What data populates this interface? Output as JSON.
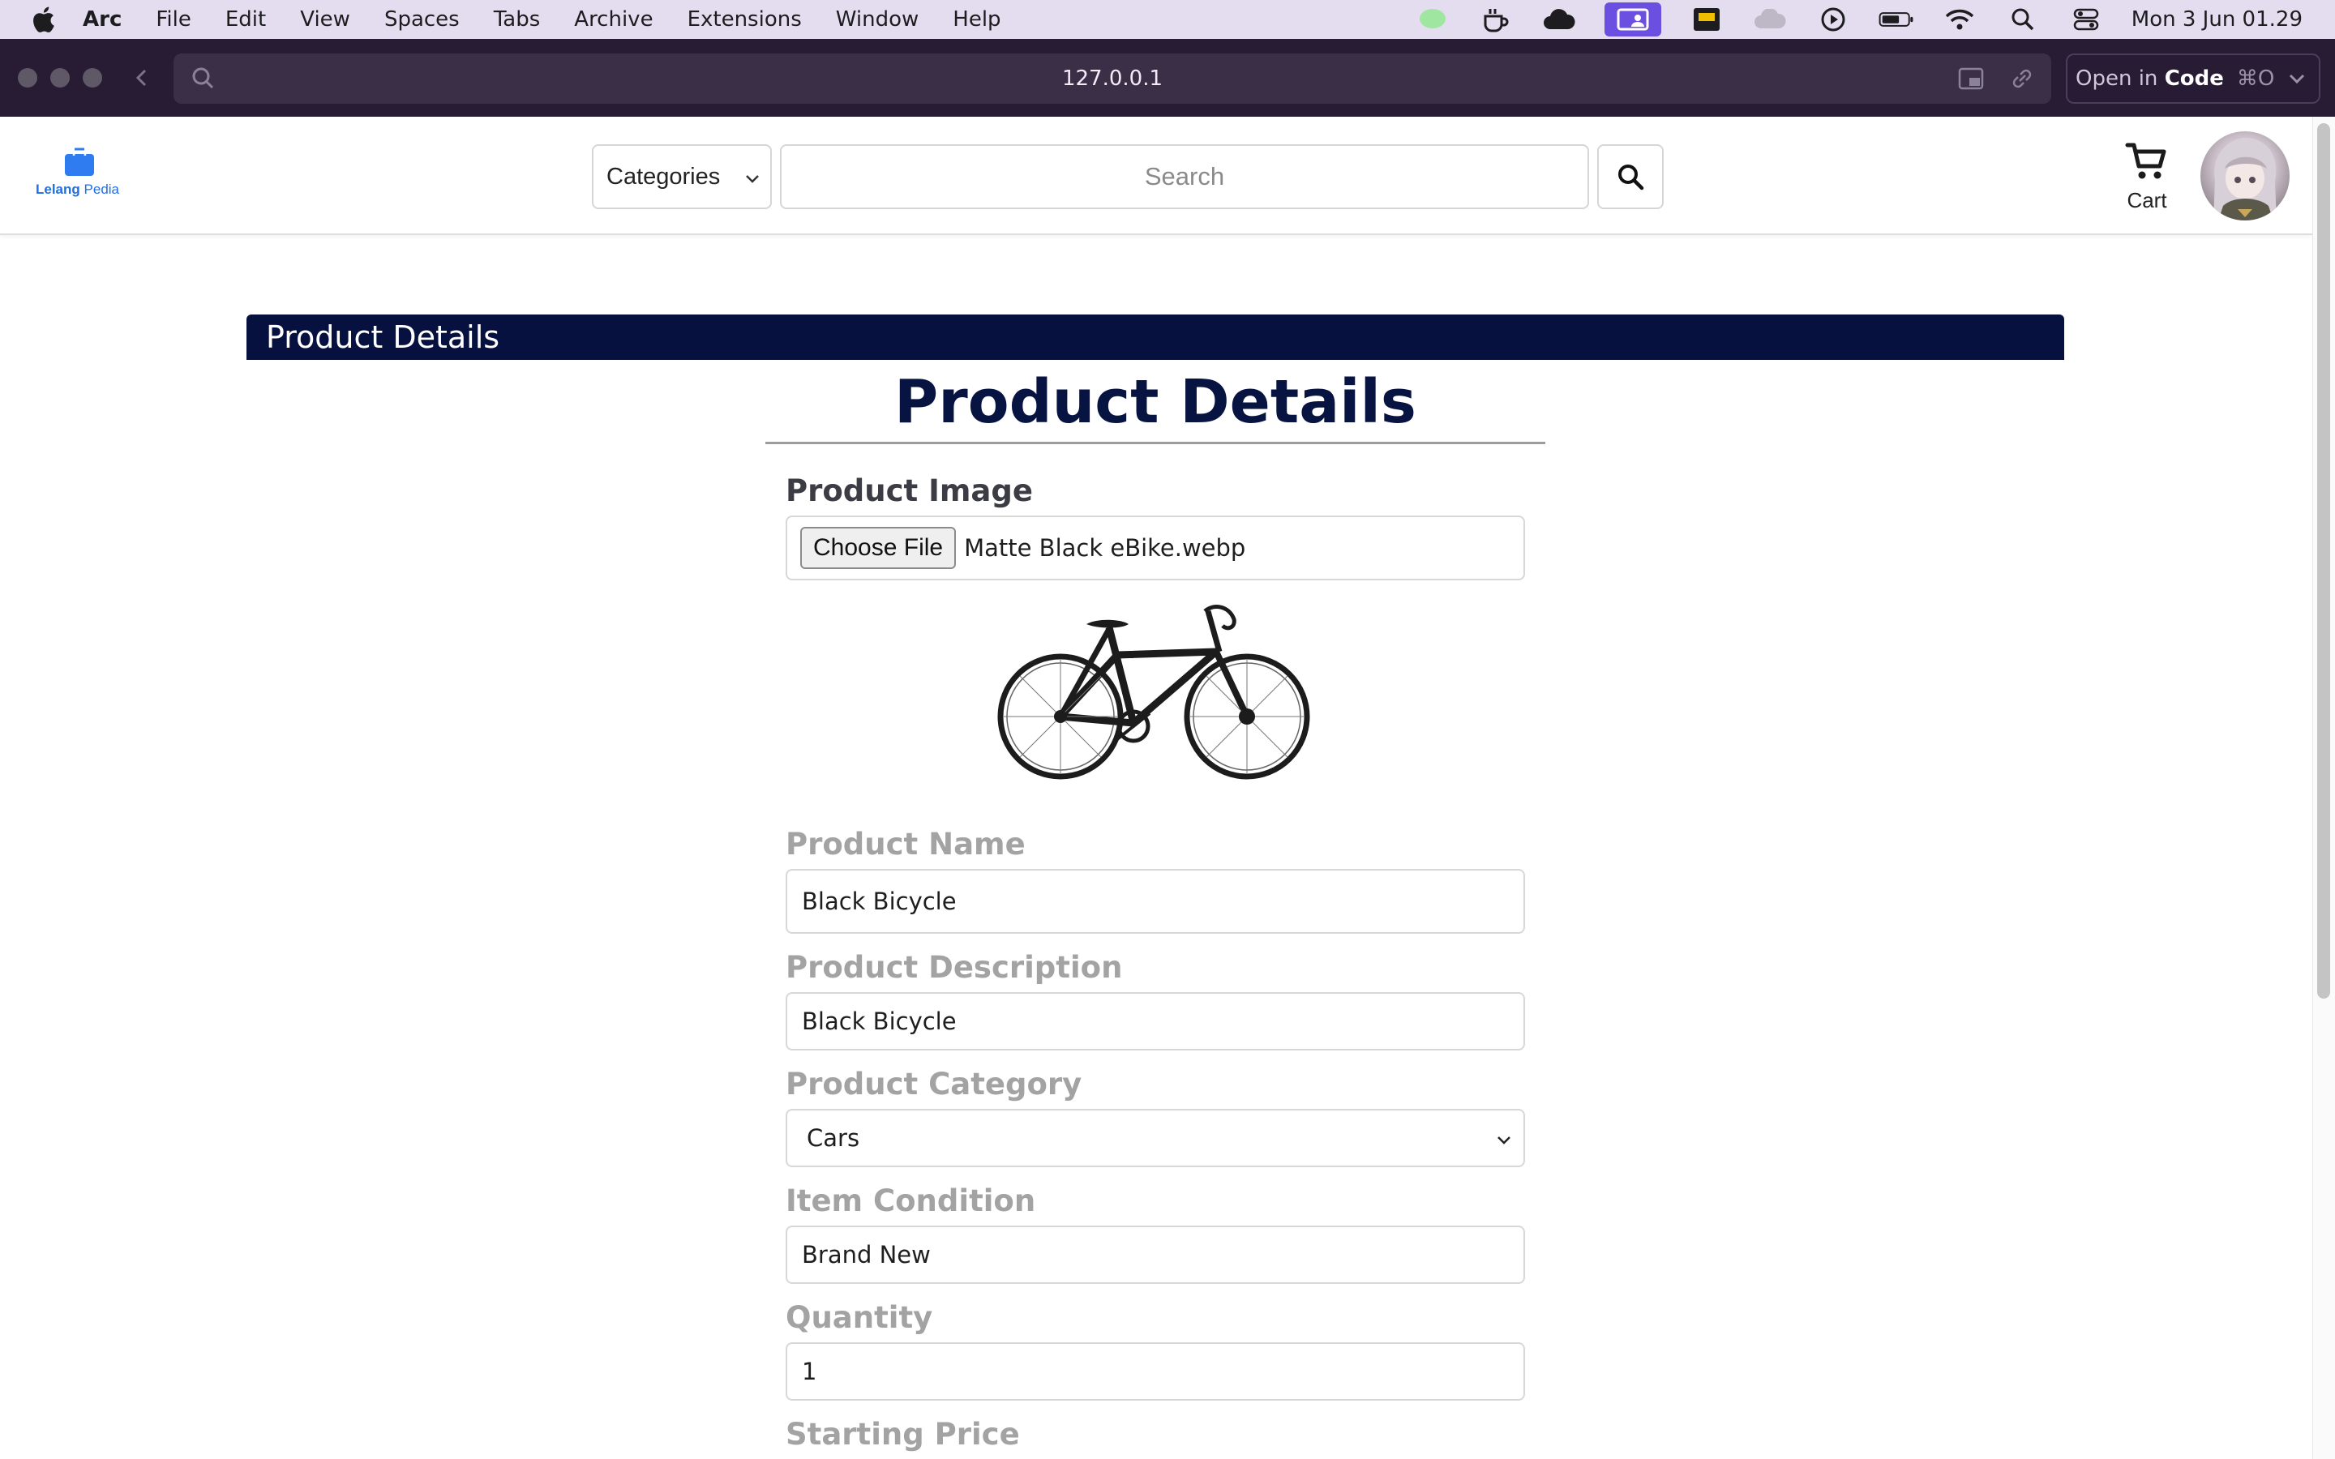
{
  "menubar": {
    "app_name": "Arc",
    "items": [
      "File",
      "Edit",
      "View",
      "Spaces",
      "Tabs",
      "Archive",
      "Extensions",
      "Window",
      "Help"
    ],
    "clock": "Mon 3 Jun  01.29"
  },
  "browser": {
    "url": "127.0.0.1",
    "open_in_prefix": "Open in",
    "open_in_app": "Code",
    "open_in_shortcut": "⌘O"
  },
  "header": {
    "logo_word1": "Lelang",
    "logo_word2": "Pedia",
    "categories_label": "Categories",
    "search_placeholder": "Search",
    "cart_label": "Cart"
  },
  "banner": {
    "title": "Product Details"
  },
  "form": {
    "title": "Product Details",
    "image_label": "Product Image",
    "choose_file_label": "Choose File",
    "file_name": "Matte Black eBike.webp",
    "name_label": "Product Name",
    "name_value": "Black Bicycle",
    "description_label": "Product Description",
    "description_value": "Black Bicycle",
    "category_label": "Product Category",
    "category_value": "Cars",
    "condition_label": "Item Condition",
    "condition_value": "Brand New",
    "quantity_label": "Quantity",
    "quantity_value": "1",
    "starting_price_label": "Starting Price"
  },
  "colors": {
    "banner_bg": "#061140",
    "title_color": "#071340",
    "brand_blue": "#1f6fe5",
    "chrome_bg": "#271c33"
  }
}
